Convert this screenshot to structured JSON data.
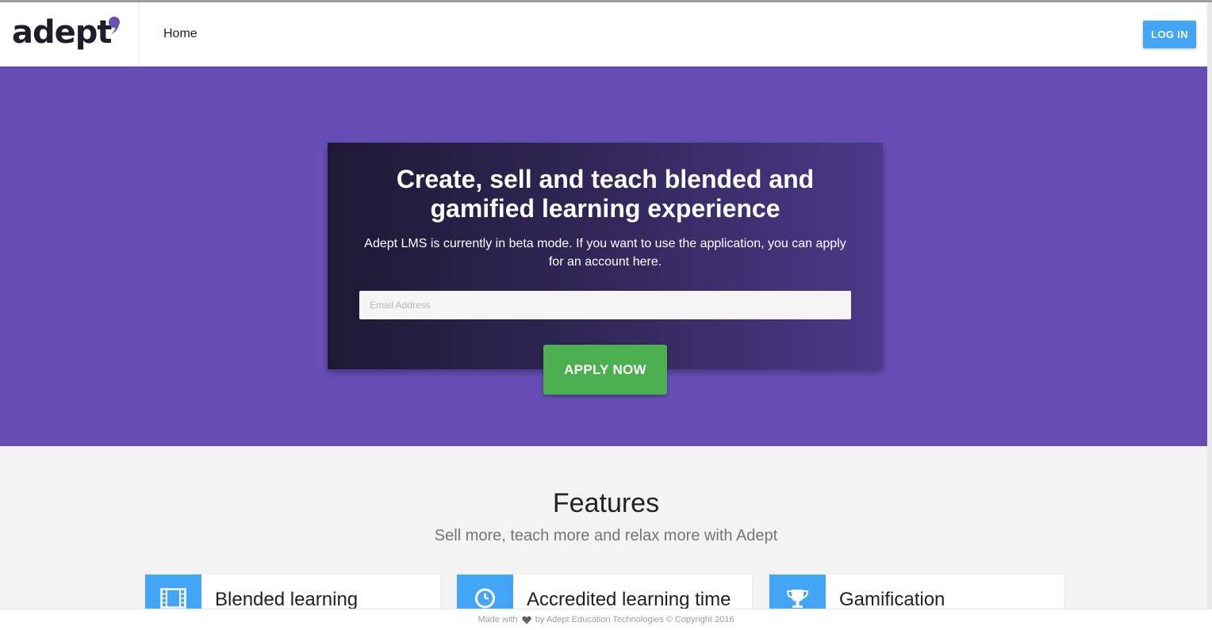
{
  "navbar": {
    "logo_text": "adept",
    "home_label": "Home",
    "login_label": "LOG IN"
  },
  "hero": {
    "title": "Create, sell and teach blended and gamified learning experience",
    "subtitle": "Adept LMS is currently in beta mode. If you want to use the application, you can apply for an account here.",
    "email_placeholder": "Email Address",
    "email_value": "",
    "apply_label": "APPLY NOW"
  },
  "features": {
    "title": "Features",
    "subtitle": "Sell more, teach more and relax more with Adept",
    "items": [
      {
        "title": "Blended learning",
        "icon": "film-icon"
      },
      {
        "title": "Accredited learning time",
        "icon": "clock-icon"
      },
      {
        "title": "Gamification",
        "icon": "trophy-icon"
      }
    ]
  },
  "footer": {
    "text_before": "Made with",
    "text_after": "by Adept Education Technologies © Copyright 2016"
  },
  "colors": {
    "hero_background": "#664eb6",
    "primary_blue": "#42a5f5",
    "apply_green": "#4caf50",
    "logo_accent": "#6a4fb5"
  }
}
